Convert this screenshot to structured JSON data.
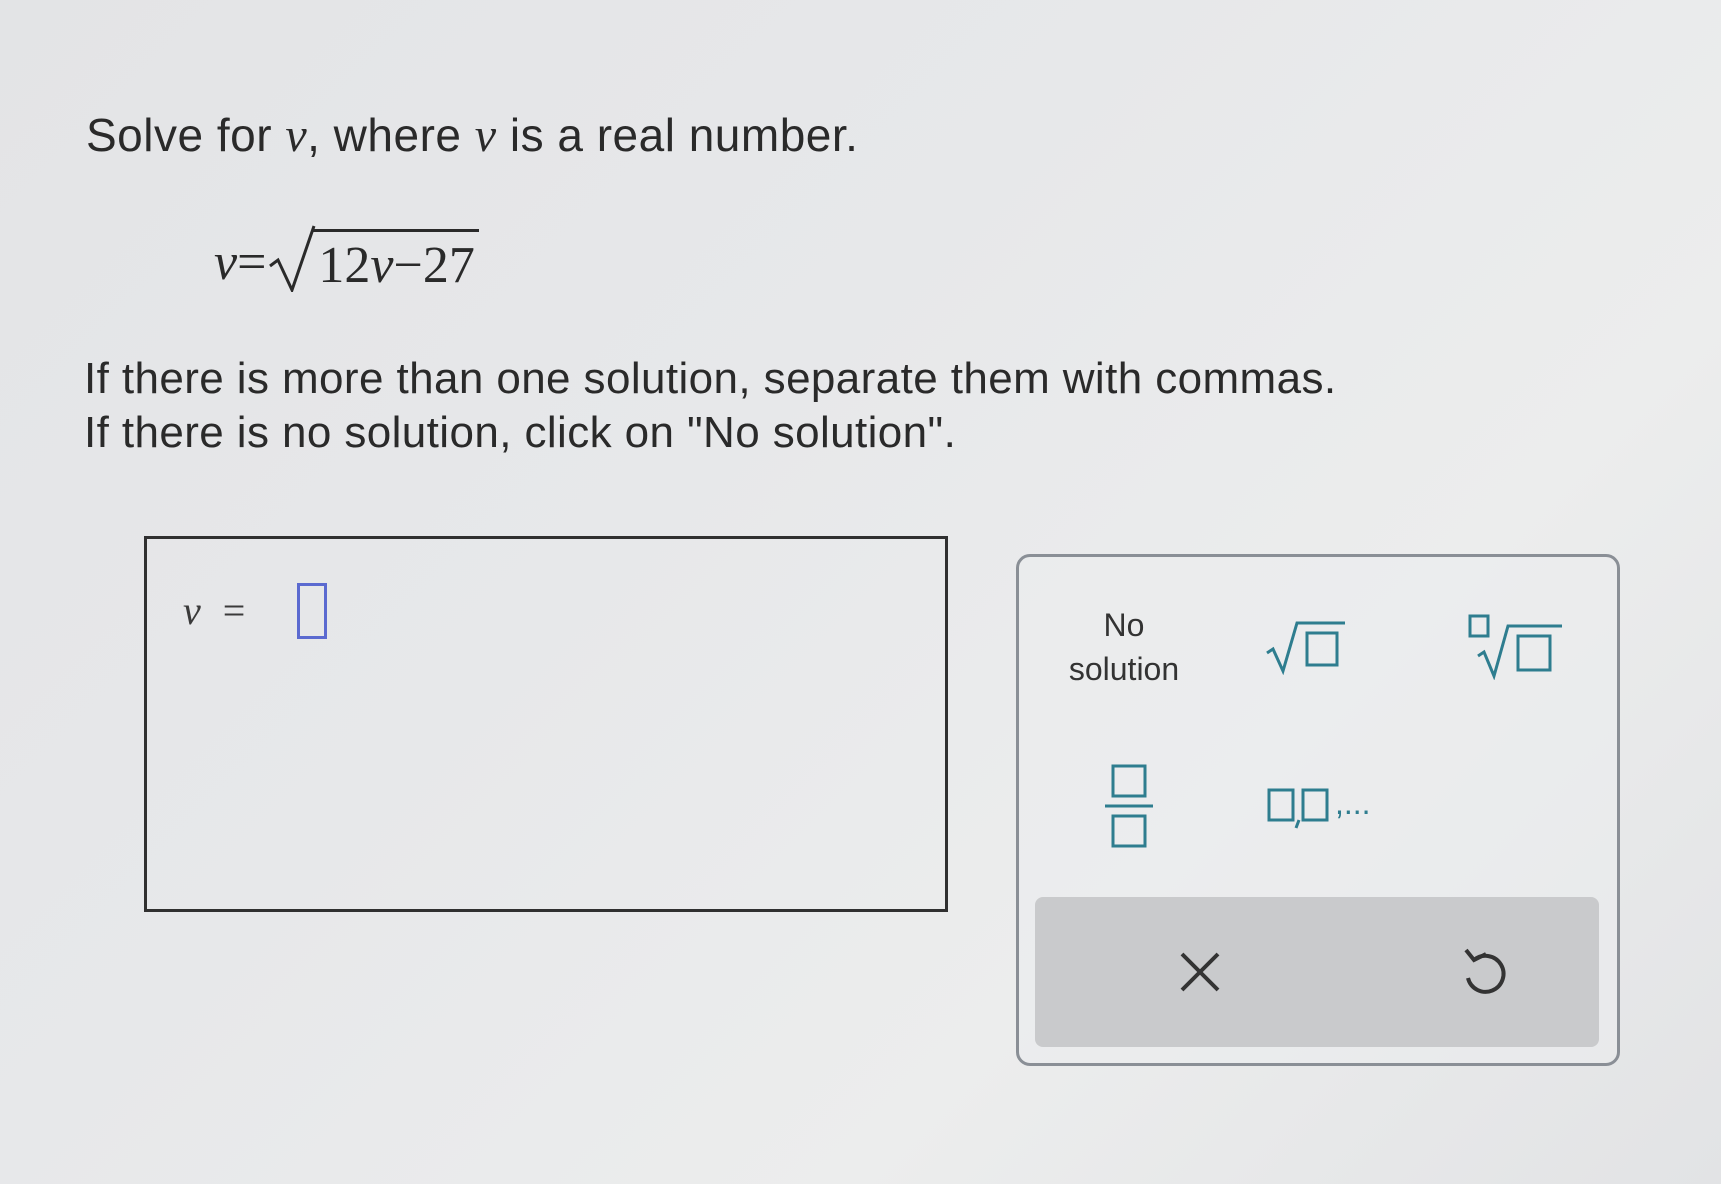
{
  "question": {
    "prompt_part1": "Solve for ",
    "prompt_var1": "v",
    "prompt_part2": ", where ",
    "prompt_var2": "v",
    "prompt_part3": " is a real number."
  },
  "equation": {
    "lhs": "v",
    "equals": "=",
    "radicand_coeff": "12",
    "radicand_var": "v",
    "radicand_rest": "−27"
  },
  "instructions": {
    "line1": "If there is more than one solution, separate them with commas.",
    "line2": "If there is no solution, click on \"No solution\"."
  },
  "answer": {
    "var": "v",
    "equals": "=",
    "value": ""
  },
  "keypad": {
    "no_solution_line1": "No",
    "no_solution_line2": "solution",
    "sqrt_icon": "square-root-icon",
    "nth_root_icon": "nth-root-icon",
    "fraction_icon": "fraction-icon",
    "list_icon": "comma-list-icon",
    "list_suffix": ",...",
    "clear_icon": "close-icon",
    "undo_icon": "undo-icon"
  },
  "colors": {
    "icon_teal": "#2e7d8f",
    "slot_blue": "#5b6ad0",
    "bar_gray": "#c9cacc"
  }
}
